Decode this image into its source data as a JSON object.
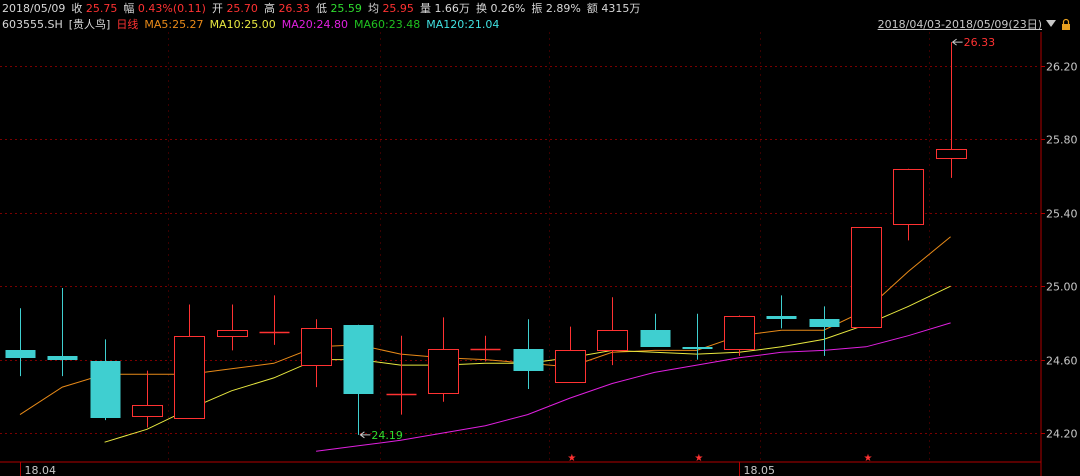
{
  "header": {
    "date": "2018/05/09",
    "close_label": "收",
    "close": "25.75",
    "change_label": "幅",
    "change": "0.43%(0.11)",
    "open_label": "开",
    "open": "25.70",
    "high_label": "高",
    "high": "26.33",
    "low_label": "低",
    "low": "25.59",
    "avg_label": "均",
    "avg": "25.95",
    "volume_label": "量",
    "volume": "1.66万",
    "turnover_label": "换",
    "turnover": "0.26%",
    "amplitude_label": "振",
    "amplitude": "2.89%",
    "amount_label": "额",
    "amount": "4315万"
  },
  "legend": {
    "code": "603555.SH",
    "name": "[贵人鸟]",
    "period": "日线",
    "ma5": "MA5:25.27",
    "ma10": "MA10:25.00",
    "ma20": "MA20:24.80",
    "ma60": "MA60:23.48",
    "ma120": "MA120:21.04",
    "date_range": "2018/04/03-2018/05/09(23日)"
  },
  "colors": {
    "background": "#000000",
    "up": "#ff3232",
    "down": "#3fcfd0",
    "ma5": "#e88a18",
    "ma10": "#e8e840",
    "ma20": "#e020e0",
    "ma60": "#20c020",
    "ma120": "#40e0e0",
    "grid": "#7a0000"
  },
  "chart_data": {
    "type": "candlestick",
    "ylim": [
      24.1,
      26.38
    ],
    "yticks": [
      "26.20",
      "25.80",
      "25.40",
      "25.00",
      "24.60",
      "24.20"
    ],
    "xticks": [
      {
        "index": 0,
        "label": "18.04"
      },
      {
        "index": 17,
        "label": "18.05"
      }
    ],
    "candles": [
      {
        "open": 24.65,
        "close": 24.61,
        "high": 24.88,
        "low": 24.51
      },
      {
        "open": 24.62,
        "close": 24.6,
        "high": 24.99,
        "low": 24.51
      },
      {
        "open": 24.59,
        "close": 24.28,
        "high": 24.71,
        "low": 24.27
      },
      {
        "open": 24.29,
        "close": 24.35,
        "high": 24.54,
        "low": 24.23
      },
      {
        "open": 24.28,
        "close": 24.73,
        "high": 24.9,
        "low": 24.28
      },
      {
        "open": 24.73,
        "close": 24.76,
        "high": 24.9,
        "low": 24.65
      },
      {
        "open": 24.75,
        "close": 24.75,
        "high": 24.95,
        "low": 24.68
      },
      {
        "open": 24.57,
        "close": 24.77,
        "high": 24.82,
        "low": 24.45
      },
      {
        "open": 24.79,
        "close": 24.41,
        "high": 24.79,
        "low": 24.19
      },
      {
        "open": 24.41,
        "close": 24.41,
        "high": 24.73,
        "low": 24.3
      },
      {
        "open": 24.42,
        "close": 24.66,
        "high": 24.83,
        "low": 24.37
      },
      {
        "open": 24.66,
        "close": 24.66,
        "high": 24.73,
        "low": 24.59
      },
      {
        "open": 24.66,
        "close": 24.54,
        "high": 24.82,
        "low": 24.44
      },
      {
        "open": 24.48,
        "close": 24.65,
        "high": 24.78,
        "low": 24.48
      },
      {
        "open": 24.65,
        "close": 24.76,
        "high": 24.94,
        "low": 24.57
      },
      {
        "open": 24.76,
        "close": 24.67,
        "high": 24.85,
        "low": 24.67
      },
      {
        "open": 24.67,
        "close": 24.66,
        "high": 24.85,
        "low": 24.6
      },
      {
        "open": 24.66,
        "close": 24.84,
        "high": 24.84,
        "low": 24.62
      },
      {
        "open": 24.84,
        "close": 24.82,
        "high": 24.95,
        "low": 24.77
      },
      {
        "open": 24.82,
        "close": 24.78,
        "high": 24.89,
        "low": 24.62
      },
      {
        "open": 24.78,
        "close": 25.32,
        "high": 25.32,
        "low": 24.78
      },
      {
        "open": 25.34,
        "close": 25.64,
        "high": 25.64,
        "low": 25.25
      },
      {
        "open": 25.7,
        "close": 25.75,
        "high": 26.33,
        "low": 25.59
      }
    ],
    "markers": [
      {
        "index": 23,
        "price": 26.33,
        "label": "26.33",
        "side": "right",
        "color": "#ff3232"
      },
      {
        "index": 8,
        "price": 24.19,
        "label": "24.19",
        "side": "right",
        "color": "#2fdc2f"
      }
    ],
    "star_indices": [
      13,
      16,
      20
    ],
    "series": [
      {
        "name": "MA5",
        "color": "#e88a18",
        "values": [
          24.3,
          24.45,
          24.52,
          24.52,
          24.52,
          24.55,
          24.58,
          24.67,
          24.68,
          24.63,
          24.61,
          24.6,
          24.58,
          24.56,
          24.64,
          24.65,
          24.65,
          24.73,
          24.76,
          24.76,
          24.87,
          25.08,
          25.27
        ]
      },
      {
        "name": "MA10",
        "color": "#e8e840",
        "values": [
          null,
          null,
          24.15,
          24.22,
          24.33,
          24.43,
          24.5,
          24.6,
          24.6,
          24.57,
          24.57,
          24.58,
          24.58,
          24.61,
          24.65,
          24.64,
          24.63,
          24.64,
          24.67,
          24.71,
          24.79,
          24.89,
          25.0
        ]
      },
      {
        "name": "MA20",
        "color": "#e020e0",
        "values": [
          null,
          null,
          null,
          null,
          null,
          null,
          null,
          24.1,
          24.13,
          24.16,
          24.2,
          24.24,
          24.3,
          24.39,
          24.47,
          24.53,
          24.57,
          24.61,
          24.64,
          24.65,
          24.67,
          24.73,
          24.8
        ]
      }
    ]
  }
}
